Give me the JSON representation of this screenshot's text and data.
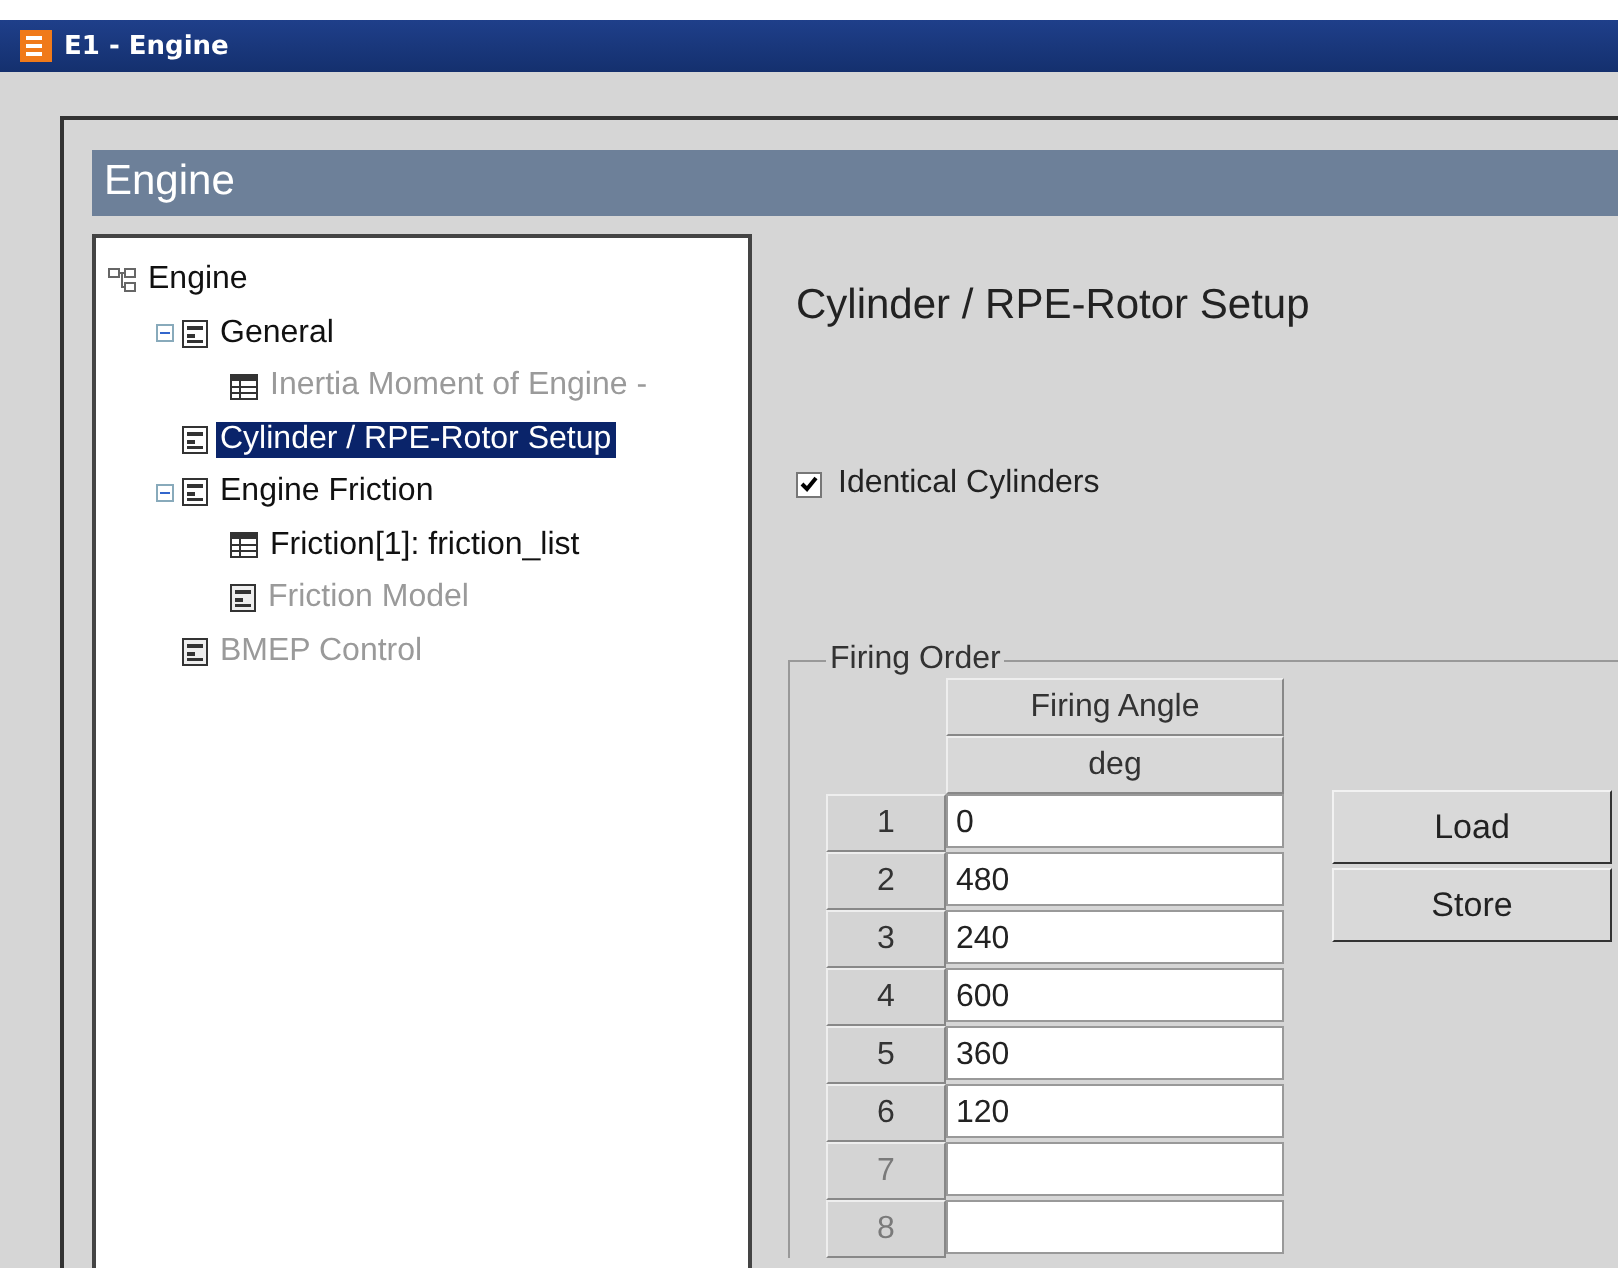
{
  "window": {
    "title": "E1 - Engine"
  },
  "panel": {
    "title": "Engine"
  },
  "tree": {
    "label": "Engine",
    "children": [
      {
        "label": "General",
        "kind": "form",
        "expanded": true,
        "disabled": false,
        "selected": false,
        "children": [
          {
            "label": "Inertia Moment of Engine - ",
            "kind": "table",
            "disabled": true,
            "selected": false
          }
        ]
      },
      {
        "label": "Cylinder / RPE-Rotor Setup",
        "kind": "form",
        "disabled": false,
        "selected": true
      },
      {
        "label": "Engine Friction",
        "kind": "form",
        "expanded": true,
        "disabled": false,
        "selected": false,
        "children": [
          {
            "label": "Friction[1]: friction_list",
            "kind": "table",
            "disabled": false,
            "selected": false
          },
          {
            "label": "Friction Model",
            "kind": "form",
            "disabled": true,
            "selected": false
          }
        ]
      },
      {
        "label": "BMEP Control",
        "kind": "form",
        "disabled": true,
        "selected": false
      }
    ]
  },
  "setup": {
    "heading": "Cylinder / RPE-Rotor Setup",
    "identical_cylinders": {
      "label": "Identical Cylinders",
      "checked": true
    },
    "firing_order": {
      "legend": "Firing Order",
      "column": "Firing Angle",
      "unit": "deg",
      "rows": [
        {
          "index": "1",
          "value": "0",
          "disabled": false
        },
        {
          "index": "2",
          "value": "480",
          "disabled": false
        },
        {
          "index": "3",
          "value": "240",
          "disabled": false
        },
        {
          "index": "4",
          "value": "600",
          "disabled": false
        },
        {
          "index": "5",
          "value": "360",
          "disabled": false
        },
        {
          "index": "6",
          "value": "120",
          "disabled": false
        },
        {
          "index": "7",
          "disabled": true
        },
        {
          "index": "8",
          "disabled": true
        }
      ],
      "buttons": [
        "Load",
        "Store"
      ]
    }
  }
}
